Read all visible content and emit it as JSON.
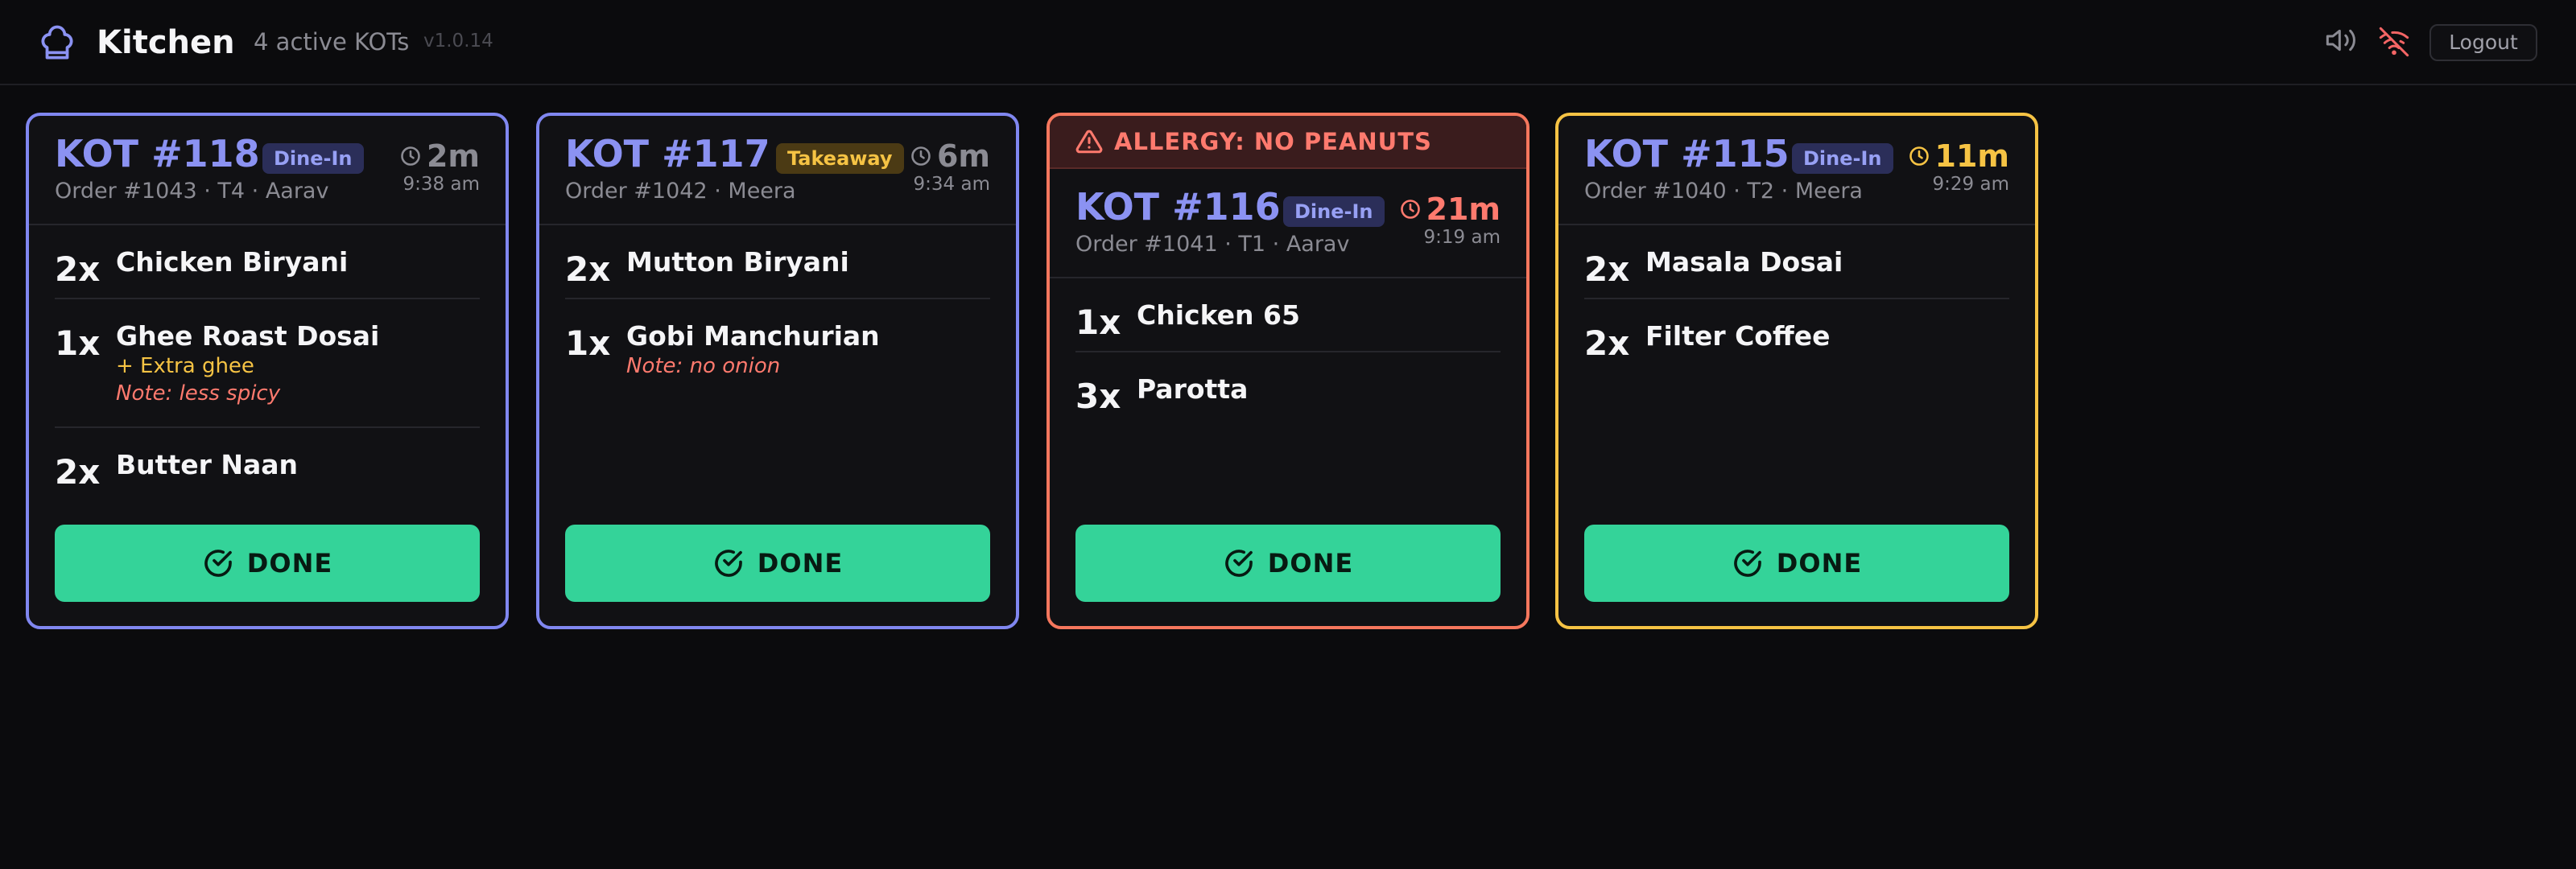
{
  "header": {
    "title": "Kitchen",
    "active_count": "4 active KOTs",
    "version": "v1.0.14",
    "logout_label": "Logout",
    "icons": {
      "logo": "chef-hat-icon",
      "sound": "speaker-icon",
      "network": "wifi-off-icon"
    }
  },
  "colors": {
    "background": "#0b0b0d",
    "card_border_default": "#8087f0",
    "card_border_allergy": "#f6775d",
    "card_border_late": "#f6c344",
    "done_button": "#34d399",
    "accent": "#8b92f2"
  },
  "done_label": "DONE",
  "kots": [
    {
      "number": "KOT #118",
      "type": "Dine-In",
      "meta": "Order #1043 · T4 · Aarav",
      "elapsed": "2m",
      "placed": "9:38 am",
      "items": [
        {
          "qty": "2x",
          "name": "Chicken Biryani"
        },
        {
          "qty": "1x",
          "name": "Ghee Roast Dosai",
          "addon": "+ Extra ghee",
          "note": "Note: less spicy"
        },
        {
          "qty": "2x",
          "name": "Butter Naan"
        }
      ]
    },
    {
      "number": "KOT #117",
      "type": "Takeaway",
      "meta": "Order #1042 · Meera",
      "elapsed": "6m",
      "placed": "9:34 am",
      "items": [
        {
          "qty": "2x",
          "name": "Mutton Biryani"
        },
        {
          "qty": "1x",
          "name": "Gobi Manchurian",
          "note": "Note: no onion"
        }
      ]
    },
    {
      "number": "KOT #116",
      "type": "Dine-In",
      "allergy": "ALLERGY: NO PEANUTS",
      "meta": "Order #1041 · T1 · Aarav",
      "elapsed": "21m",
      "placed": "9:19 am",
      "items": [
        {
          "qty": "1x",
          "name": "Chicken 65"
        },
        {
          "qty": "3x",
          "name": "Parotta"
        }
      ]
    },
    {
      "number": "KOT #115",
      "type": "Dine-In",
      "meta": "Order #1040 · T2 · Meera",
      "elapsed": "11m",
      "placed": "9:29 am",
      "items": [
        {
          "qty": "2x",
          "name": "Masala Dosai"
        },
        {
          "qty": "2x",
          "name": "Filter Coffee"
        }
      ]
    }
  ]
}
